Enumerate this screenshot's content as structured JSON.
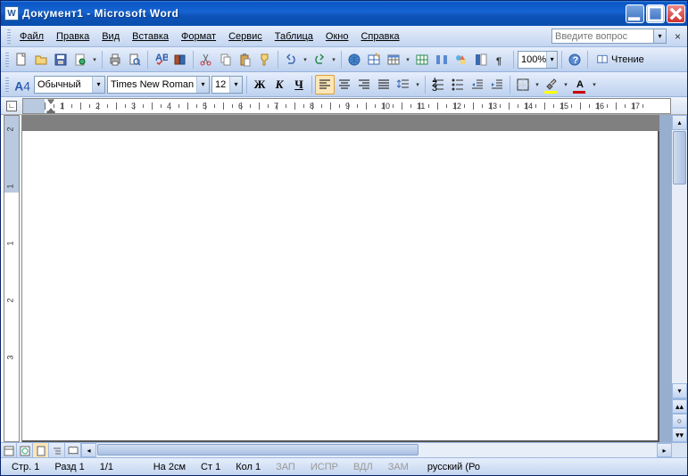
{
  "title": "Документ1 - Microsoft Word",
  "menu": {
    "file": "Файл",
    "edit": "Правка",
    "view": "Вид",
    "insert": "Вставка",
    "format": "Формат",
    "tools": "Сервис",
    "table": "Таблица",
    "window": "Окно",
    "help": "Справка"
  },
  "help_placeholder": "Введите вопрос",
  "toolbar": {
    "zoom": "100%",
    "reading": "Чтение"
  },
  "format": {
    "style": "Обычный",
    "font": "Times New Roman",
    "size": "12",
    "bold": "Ж",
    "italic": "К",
    "underline": "Ч",
    "A": "A"
  },
  "ruler": {
    "start": 1,
    "end": 17,
    "count": 17
  },
  "vruler": [
    "2",
    "1",
    "1",
    "2",
    "3"
  ],
  "status": {
    "page": "Стр. 1",
    "section": "Разд 1",
    "pages": "1/1",
    "at": "На 2см",
    "line": "Ст 1",
    "col": "Кол 1",
    "rec": "ЗАП",
    "trk": "ИСПР",
    "ext": "ВДЛ",
    "ovr": "ЗАМ",
    "lang": "русский (Ро"
  }
}
